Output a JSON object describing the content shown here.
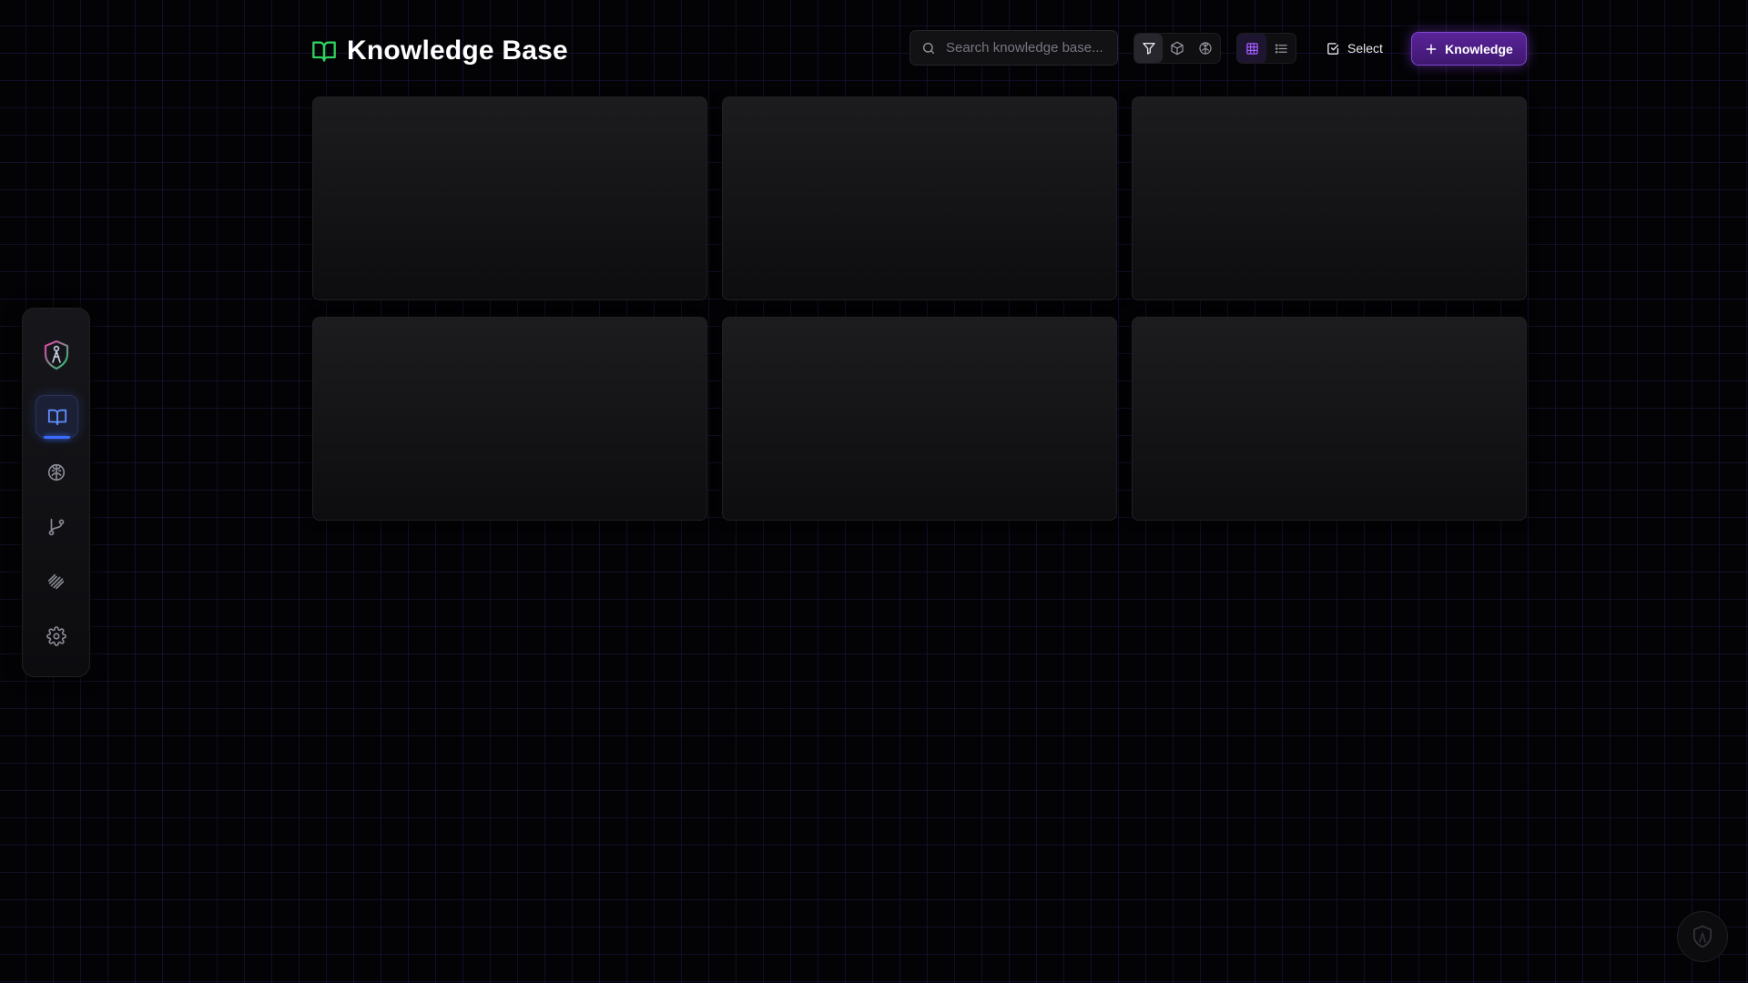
{
  "header": {
    "title": "Knowledge Base",
    "title_icon": "book-open-icon"
  },
  "search": {
    "placeholder": "Search knowledge base...",
    "value": ""
  },
  "toolbar": {
    "filters": [
      {
        "icon": "funnel-icon",
        "active": true
      },
      {
        "icon": "cube-icon",
        "active": false
      },
      {
        "icon": "brain-icon",
        "active": false
      }
    ],
    "views": [
      {
        "icon": "grid-icon",
        "active": true
      },
      {
        "icon": "list-icon",
        "active": false
      }
    ],
    "select_label": "Select",
    "add_label": "Knowledge"
  },
  "sidebar": {
    "items": [
      {
        "icon": "shield-logo-icon",
        "active": false
      },
      {
        "icon": "book-open-icon",
        "active": true
      },
      {
        "icon": "brain-icon",
        "active": false
      },
      {
        "icon": "git-branch-icon",
        "active": false
      },
      {
        "icon": "layers-icon",
        "active": false
      },
      {
        "icon": "gear-icon",
        "active": false
      }
    ]
  },
  "cards": {
    "state": "loading",
    "count": 6
  },
  "colors": {
    "background": "#030305",
    "grid": "#2e2466",
    "accent_purple": "#8a3ff0",
    "title_icon_green": "#31d25f",
    "active_nav_blue": "#3b6cff"
  }
}
